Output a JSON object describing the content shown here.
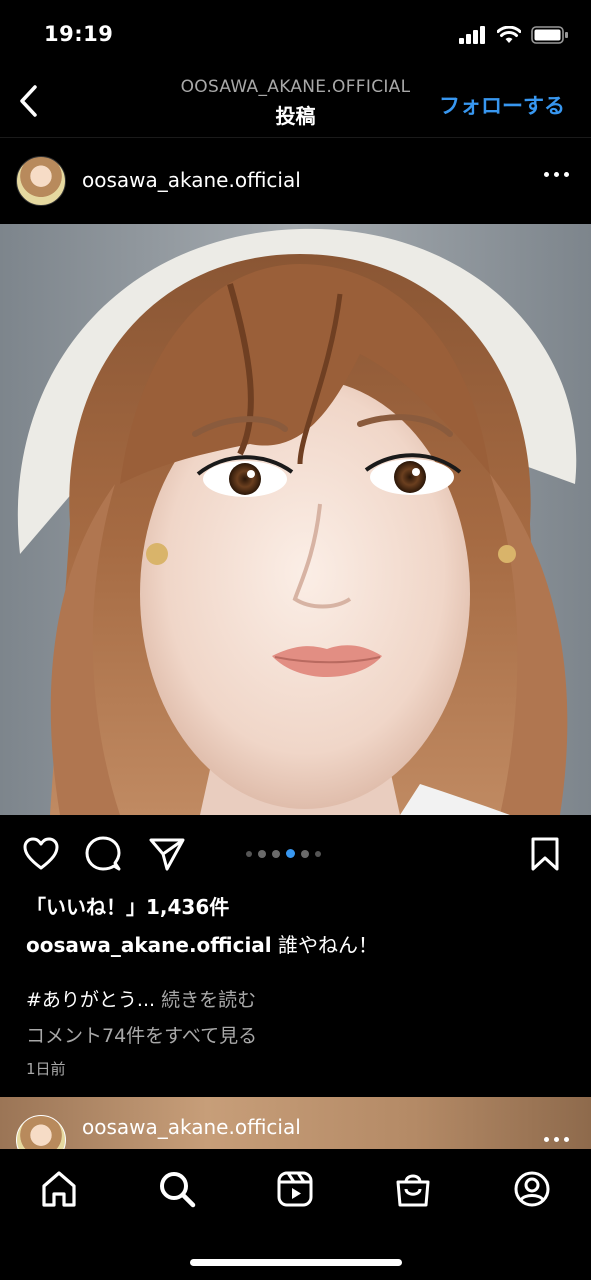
{
  "status_bar": {
    "time": "19:19"
  },
  "header": {
    "account_name": "OOSAWA_AKANE.OFFICIAL",
    "title": "投稿",
    "follow_label": "フォローする"
  },
  "post": {
    "username": "oosawa_akane.official",
    "likes_label": "「いいね！」1,436件",
    "caption_username": "oosawa_akane.official",
    "caption_text": " 誰やねん！",
    "hashtag_text": "#ありがとう...",
    "read_more_label": "続きを読む",
    "comments_label": "コメント74件をすべて見る",
    "timestamp": "1日前",
    "carousel": {
      "total": 6,
      "active_index": 3
    }
  },
  "next_post": {
    "username": "oosawa_akane.official"
  },
  "tab_bar": {
    "items": [
      "home-icon",
      "search-icon",
      "reels-icon",
      "shop-icon",
      "profile-icon"
    ]
  },
  "colors": {
    "accent": "#3897f0",
    "background": "#000000",
    "secondary_text": "#a8a8a8"
  }
}
